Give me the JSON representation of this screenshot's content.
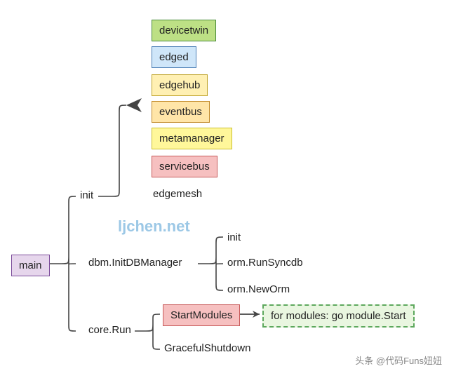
{
  "root": {
    "label": "main"
  },
  "branches": {
    "init": {
      "label": "init",
      "modules": [
        {
          "label": "devicetwin",
          "fill": "#bde085",
          "border": "#4b8b3b"
        },
        {
          "label": "edged",
          "fill": "#cfe6f9",
          "border": "#4a7db5"
        },
        {
          "label": "edgehub",
          "fill": "#fff0b3",
          "border": "#bfa32a"
        },
        {
          "label": "eventbus",
          "fill": "#ffe5a8",
          "border": "#c28a2a"
        },
        {
          "label": "metamanager",
          "fill": "#fff79a",
          "border": "#cbbf2e"
        },
        {
          "label": "servicebus",
          "fill": "#f6c0c0",
          "border": "#c75a5a"
        },
        {
          "label": "edgemesh",
          "fill": "",
          "border": ""
        }
      ]
    },
    "dbm": {
      "label": "dbm.InitDBManager",
      "children": {
        "init": "init",
        "syncdb": "orm.RunSyncdb",
        "neworm": "orm.NewOrm"
      }
    },
    "coreRun": {
      "label": "core.Run",
      "children": {
        "start": "StartModules",
        "shutdown": "GracefulShutdown"
      }
    }
  },
  "flow": {
    "target": "for modules: go module.Start"
  },
  "watermark": "ljchen.net",
  "attribution": "头条 @代码Funs妞妞",
  "colors": {
    "main_fill": "#e6d6ec",
    "main_border": "#7a4a99",
    "start_fill": "#f6c0c0",
    "start_border": "#c75a5a",
    "flow_fill": "#e9f6e0",
    "flow_border": "#5da85d"
  }
}
